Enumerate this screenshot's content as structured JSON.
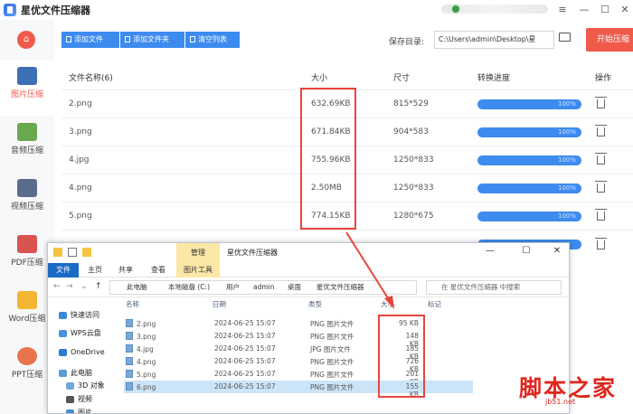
{
  "app": {
    "title": "星优文件压缩器",
    "window_controls": [
      "≡",
      "—",
      "☐",
      "✕"
    ]
  },
  "sidebar": {
    "home_icon": "home-icon",
    "items": [
      {
        "label": "图片压缩",
        "icon": "image-icon",
        "active": true
      },
      {
        "label": "音频压缩",
        "icon": "music-icon",
        "active": false
      },
      {
        "label": "视频压缩",
        "icon": "video-icon",
        "active": false
      },
      {
        "label": "PDF压缩",
        "icon": "pdf-icon",
        "active": false
      },
      {
        "label": "Word压缩",
        "icon": "word-icon",
        "active": false
      },
      {
        "label": "PPT压缩",
        "icon": "ppt-icon",
        "active": false
      }
    ]
  },
  "toolbar": {
    "add_file": "添加文件",
    "add_folder": "添加文件夹",
    "clear_list": "清空列表",
    "save_dir_label": "保存目录:",
    "save_dir_value": "C:\\Users\\admin\\Desktop\\星",
    "start_button": "开始压缩"
  },
  "table": {
    "headers": {
      "name": "文件名称(6)",
      "size": "大小",
      "dimension": "尺寸",
      "progress": "转换进度",
      "action": "操作"
    },
    "rows": [
      {
        "name": "2.png",
        "size": "632.69KB",
        "dimension": "815*529",
        "progress": "100%"
      },
      {
        "name": "3.png",
        "size": "671.84KB",
        "dimension": "904*583",
        "progress": "100%"
      },
      {
        "name": "4.jpg",
        "size": "755.96KB",
        "dimension": "1250*833",
        "progress": "100%"
      },
      {
        "name": "4.png",
        "size": "2.50MB",
        "dimension": "1250*833",
        "progress": "100%"
      },
      {
        "name": "5.png",
        "size": "774.15KB",
        "dimension": "1280*675",
        "progress": "100%"
      }
    ]
  },
  "colors": {
    "accent": "#3d8bef",
    "start_button": "#f05a4b",
    "highlight": "#e8453c"
  },
  "explorer": {
    "ribbon_context": "管理",
    "window_title": "星优文件压缩器",
    "controls": [
      "—",
      "☐",
      "✕"
    ],
    "tabs": [
      "文件",
      "主页",
      "共享",
      "查看",
      "图片工具"
    ],
    "breadcrumb": [
      "此电脑",
      "本地磁盘 (C:)",
      "用户",
      "admin",
      "桌面",
      "星优文件压缩器"
    ],
    "search_placeholder": "在 星优文件压缩器 中搜索",
    "nav": [
      "快速访问",
      "WPS云盘",
      "OneDrive",
      "此电脑",
      "3D 对象",
      "视频",
      "图片"
    ],
    "columns": [
      "名称",
      "日期",
      "类型",
      "大小",
      "标记"
    ],
    "files": [
      {
        "name": "2.png",
        "date": "2024-06-25 15:07",
        "type": "PNG 图片文件",
        "size": "95 KB",
        "selected": false
      },
      {
        "name": "3.png",
        "date": "2024-06-25 15:07",
        "type": "PNG 图片文件",
        "size": "148 KB",
        "selected": false
      },
      {
        "name": "4.jpg",
        "date": "2024-06-25 15:07",
        "type": "JPG 图片文件",
        "size": "185 KB",
        "selected": false
      },
      {
        "name": "4.png",
        "date": "2024-06-25 15:07",
        "type": "PNG 图片文件",
        "size": "726 KB",
        "selected": false
      },
      {
        "name": "5.png",
        "date": "2024-06-25 15:07",
        "type": "PNG 图片文件",
        "size": "201 KB",
        "selected": false
      },
      {
        "name": "6.png",
        "date": "2024-06-25 15:07",
        "type": "PNG 图片文件",
        "size": "155 KB",
        "selected": true
      }
    ]
  },
  "watermark": {
    "text": "脚本之家",
    "sub": "jb51.net"
  }
}
